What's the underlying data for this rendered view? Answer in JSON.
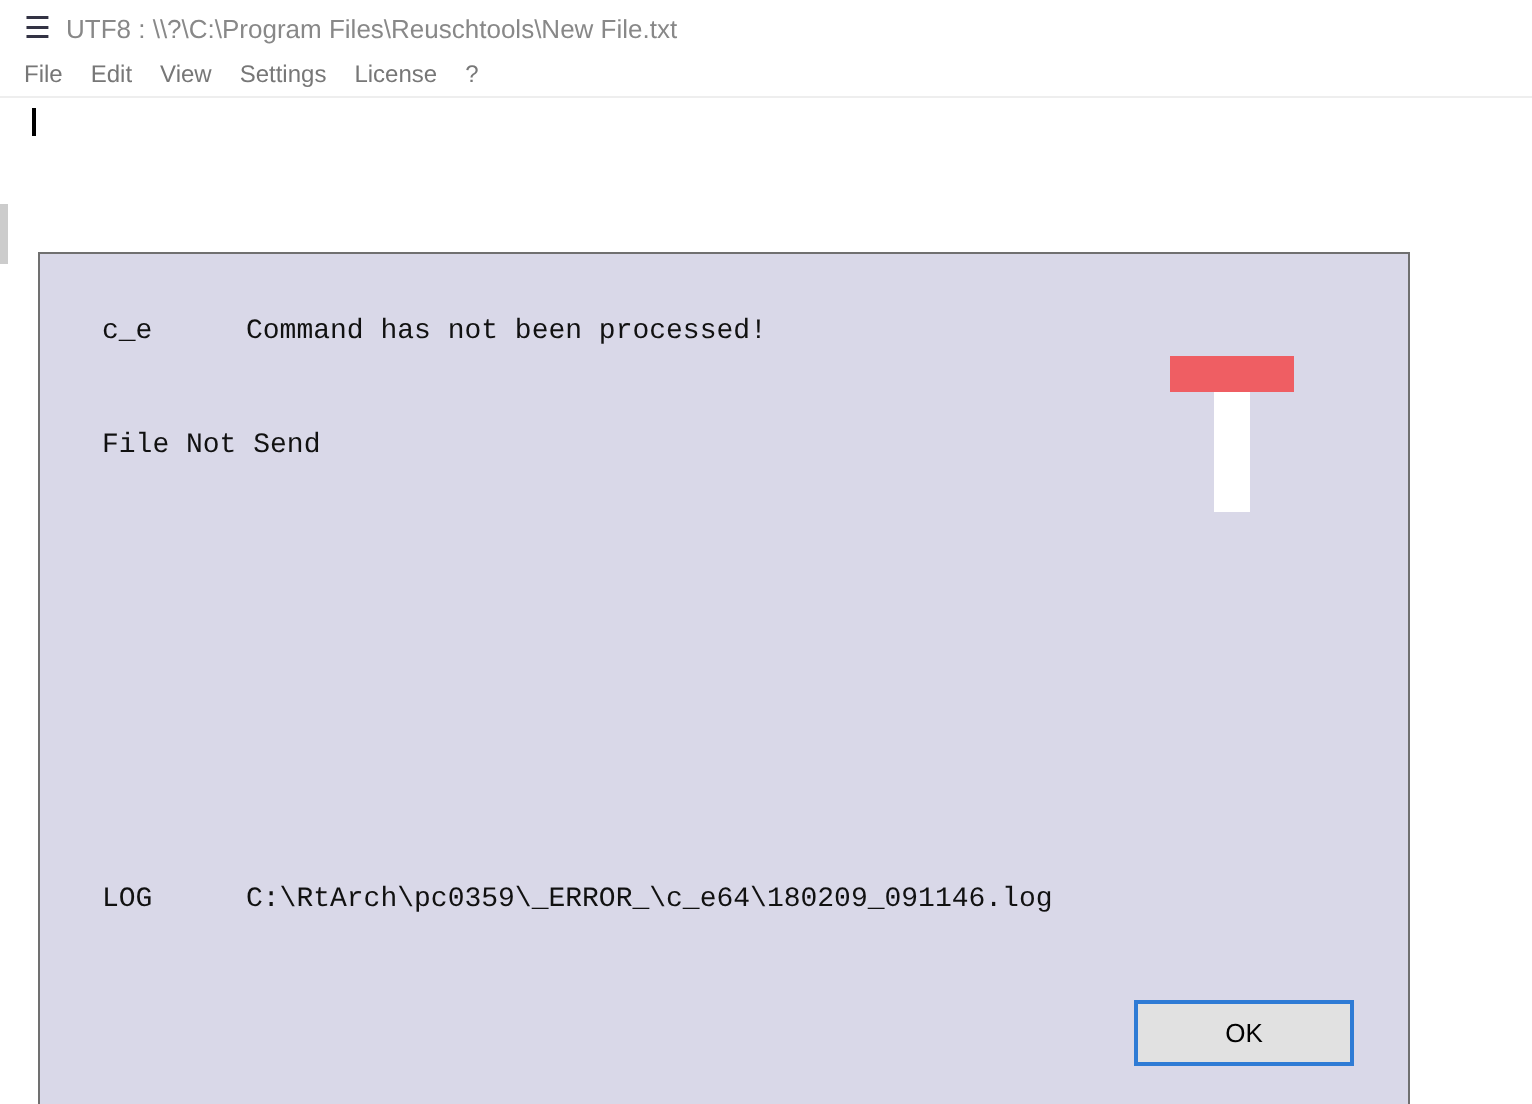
{
  "window": {
    "menu_icon": "☰",
    "title": "UTF8 : \\\\?\\C:\\Program Files\\Reuschtools\\New File.txt"
  },
  "menu": [
    "File",
    "Edit",
    "View",
    "Settings",
    "License",
    "?"
  ],
  "dialog": {
    "lines": [
      {
        "code": "c_e",
        "text": "Command has not been processed!"
      },
      {
        "text": "File Not Send"
      }
    ],
    "log": {
      "label": "LOG",
      "path": "C:\\RtArch\\pc0359\\_ERROR_\\c_e64\\180209_091146.log"
    },
    "button": "OK"
  }
}
